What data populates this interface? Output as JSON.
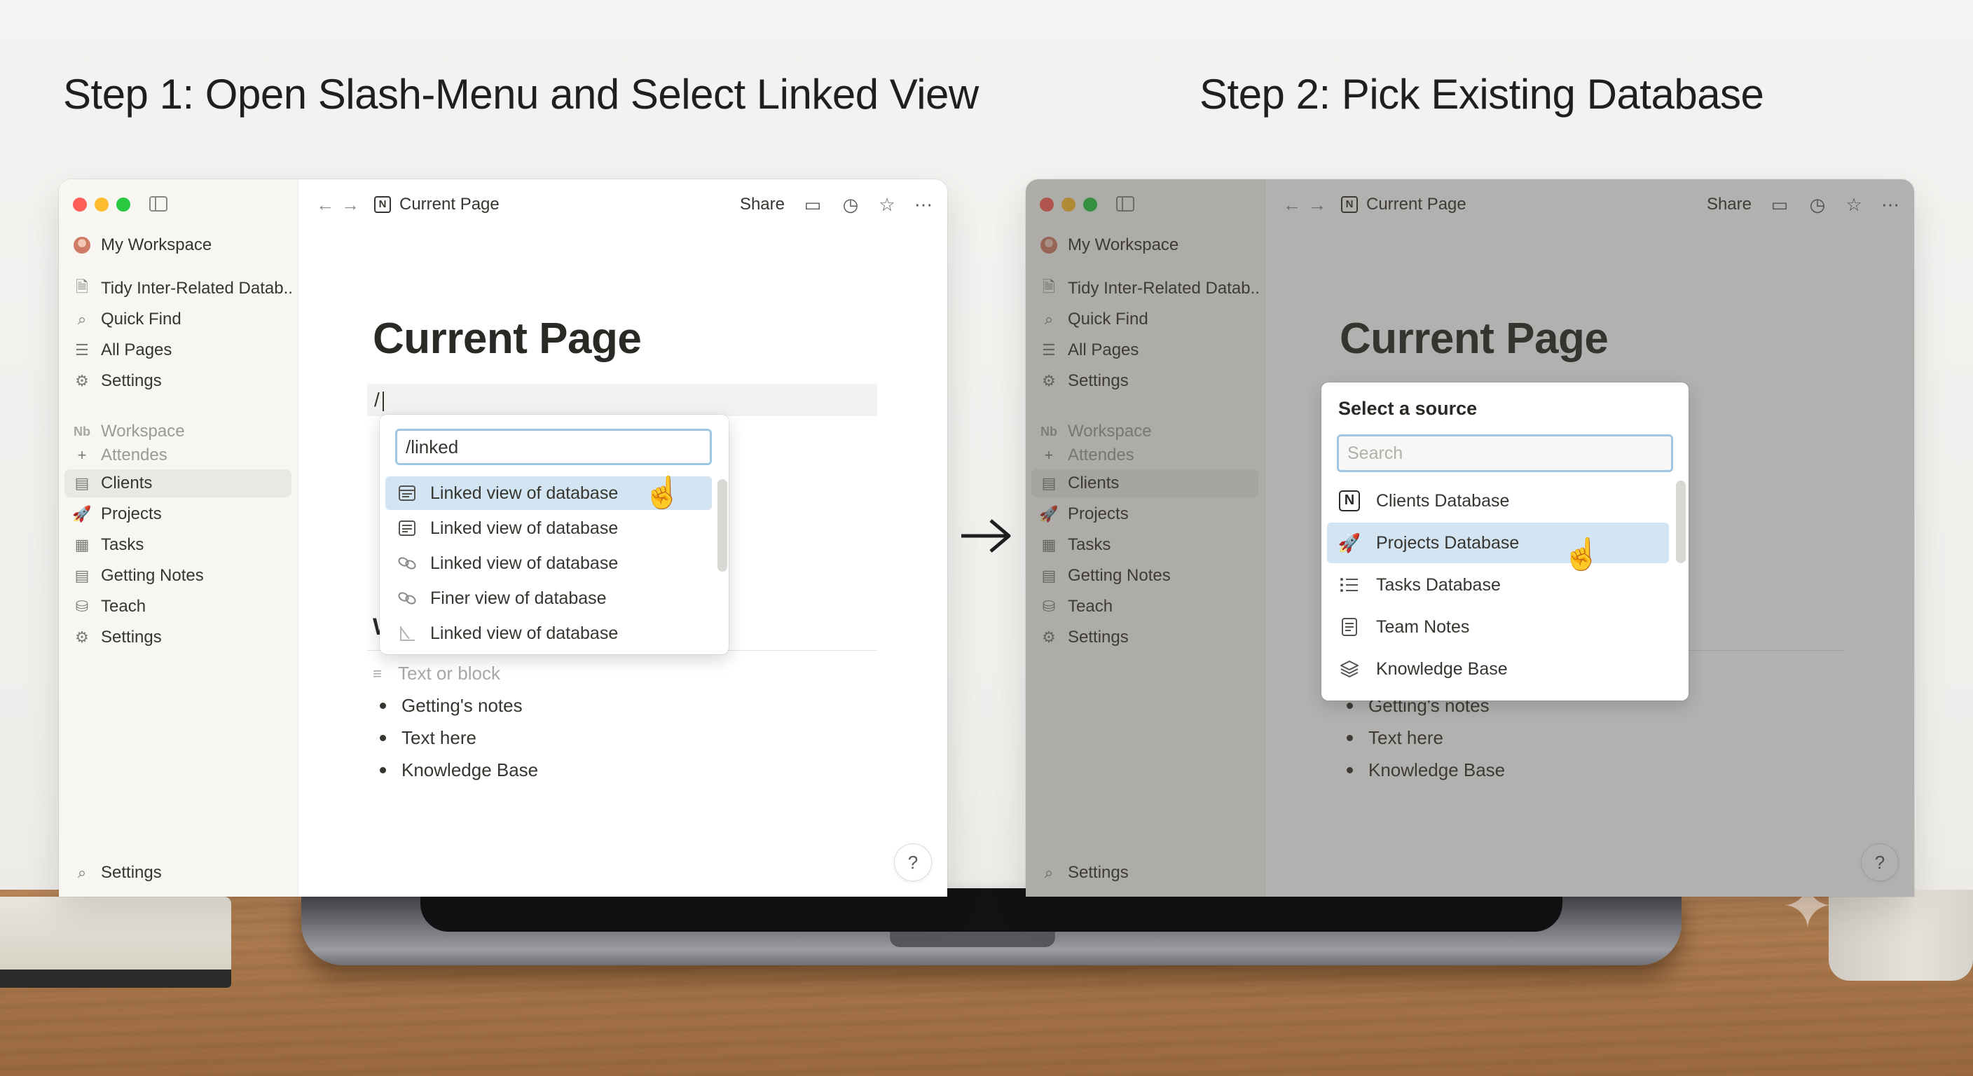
{
  "steps": {
    "step1_title": "Step 1: Open Slash-Menu and Select Linked View",
    "step2_title": "Step 2: Pick Existing Database"
  },
  "sidebar": {
    "workspace_name": "My Workspace",
    "top_items": [
      {
        "label": "Tidy Inter-Related Datab...",
        "icon": "page-icon"
      },
      {
        "label": "Quick Find",
        "icon": "search-icon"
      },
      {
        "label": "All Pages",
        "icon": "list-icon"
      },
      {
        "label": "Settings",
        "icon": "gear-icon"
      }
    ],
    "section_label": "Workspace",
    "section_badge": "Nb",
    "add_item": "Attendes",
    "items": [
      {
        "label": "Clients",
        "icon": "database-icon"
      },
      {
        "label": "Projects",
        "icon": "rocket-icon"
      },
      {
        "label": "Tasks",
        "icon": "table-icon"
      },
      {
        "label": "Getting Notes",
        "icon": "database-icon"
      },
      {
        "label": "Teach",
        "icon": "cylinder-icon"
      },
      {
        "label": "Settings",
        "icon": "gear-icon"
      }
    ],
    "footer_item": "Settings"
  },
  "topbar": {
    "breadcrumb": "Current Page",
    "share_label": "Share",
    "breadcrumb_icon_letter": "N"
  },
  "page": {
    "title": "Current Page",
    "slash_input": "/",
    "heading_fragment": "W",
    "placeholder_block": "Text or block",
    "bullets": [
      "Getting's notes",
      "Text here",
      "Knowledge Base"
    ],
    "help_label": "?"
  },
  "slash_menu": {
    "query": "/linked",
    "items": [
      {
        "label": "Linked view of database",
        "icon": "table-icon",
        "active": true
      },
      {
        "label": "Linked view of database",
        "icon": "document-icon"
      },
      {
        "label": "Linked view of database",
        "icon": "link-icon"
      },
      {
        "label": "Finer view of database",
        "icon": "link-icon"
      },
      {
        "label": "Linked view of database",
        "icon": "chart-icon"
      }
    ]
  },
  "source_menu": {
    "title": "Select a source",
    "search_placeholder": "Search",
    "items": [
      {
        "label": "Clients Database",
        "icon": "notion-logo-icon"
      },
      {
        "label": "Projects Database",
        "icon": "rocket-icon",
        "active": true
      },
      {
        "label": "Tasks Database",
        "icon": "list-icon"
      },
      {
        "label": "Team Notes",
        "icon": "document-icon"
      },
      {
        "label": "Knowledge Base",
        "icon": "layers-icon"
      }
    ]
  },
  "colors": {
    "selection": "#d3e4f2",
    "input_focus": "#9ec7e6",
    "sidebar_bg": "#f7f6f3",
    "traffic_red": "#ff5f57",
    "traffic_yellow": "#febc2e",
    "traffic_green": "#28c840"
  }
}
